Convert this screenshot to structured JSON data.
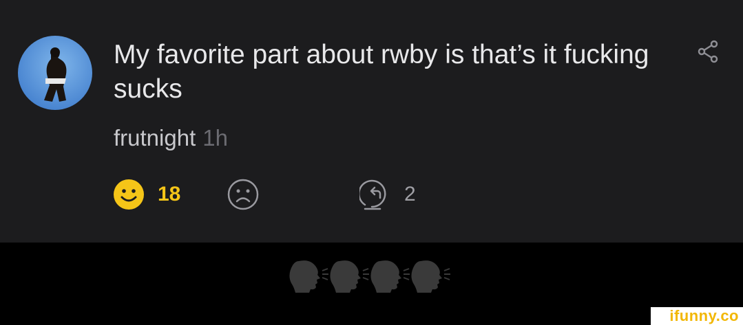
{
  "comment": {
    "text": "My favorite part about rwby is that’s it fucking sucks",
    "username": "frutnight",
    "timestamp": "1h",
    "avatar_icon": "user-avatar",
    "share_icon": "share-icon"
  },
  "actions": {
    "smile_count": "18",
    "reply_count": "2",
    "smile_color": "#f5c518",
    "icon_color": "#9a9aa0"
  },
  "reaction_strip": {
    "emoji": "speaking-head-icon",
    "count": 4
  },
  "watermark": {
    "text": "ifunny.co",
    "color": "#f2b705"
  }
}
